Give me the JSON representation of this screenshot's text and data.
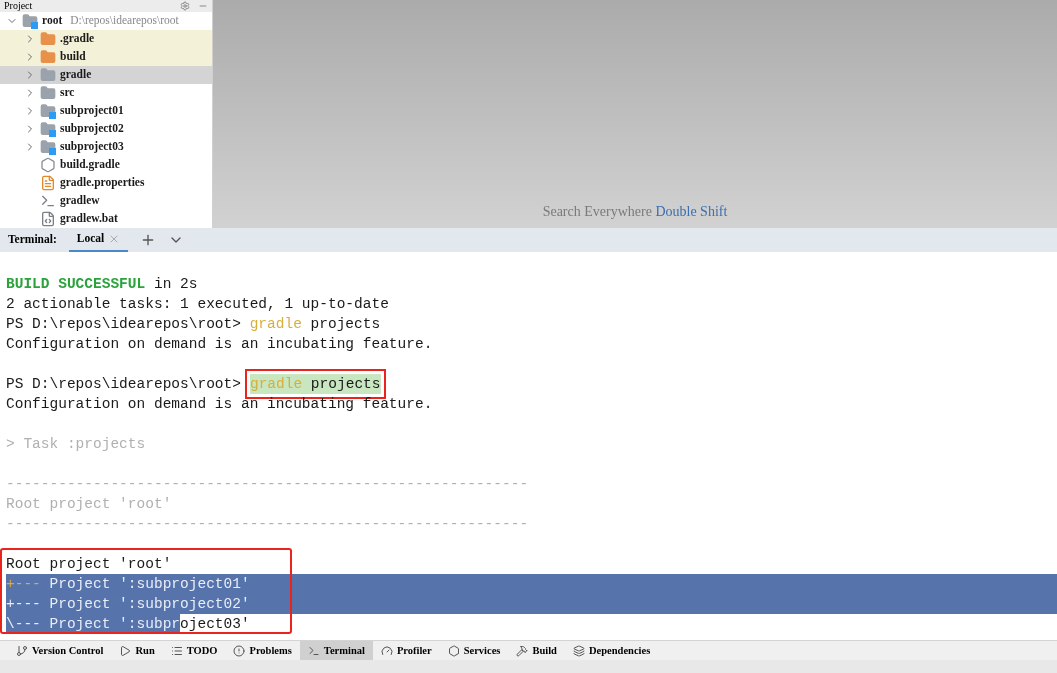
{
  "project_panel": {
    "title": "Project",
    "tree": [
      {
        "label": "root",
        "path": "D:\\repos\\idearepos\\root",
        "kind": "module",
        "expanded": true,
        "excluded": false,
        "selected": false,
        "children": [
          {
            "label": ".gradle",
            "kind": "folder",
            "expanded": false,
            "excluded": true,
            "selected": false
          },
          {
            "label": "build",
            "kind": "folder",
            "expanded": false,
            "excluded": true,
            "selected": false
          },
          {
            "label": "gradle",
            "kind": "folder",
            "expanded": false,
            "excluded": false,
            "selected": true
          },
          {
            "label": "src",
            "kind": "folder",
            "expanded": false,
            "excluded": false,
            "selected": false
          },
          {
            "label": "subproject01",
            "kind": "module",
            "expanded": false,
            "excluded": false,
            "selected": false
          },
          {
            "label": "subproject02",
            "kind": "module",
            "expanded": false,
            "excluded": false,
            "selected": false
          },
          {
            "label": "subproject03",
            "kind": "module",
            "expanded": false,
            "excluded": false,
            "selected": false
          },
          {
            "label": "build.gradle",
            "kind": "gradle",
            "excluded": false,
            "selected": false
          },
          {
            "label": "gradle.properties",
            "kind": "properties",
            "excluded": false,
            "selected": false
          },
          {
            "label": "gradlew",
            "kind": "script",
            "excluded": false,
            "selected": false
          },
          {
            "label": "gradlew.bat",
            "kind": "batch",
            "excluded": false,
            "selected": false
          }
        ]
      }
    ]
  },
  "editor_hint": {
    "text": "Search Everywhere",
    "shortcut": "Double Shift"
  },
  "terminal": {
    "title": "Terminal:",
    "tabs": [
      {
        "label": "Local",
        "selected": true
      }
    ],
    "output": [
      {
        "selected": false
      },
      {
        "selected": false,
        "segments": [
          {
            "text": "BUILD SUCCESSFUL",
            "kind": "success"
          },
          {
            "text": " in 2s",
            "kind": "normal"
          }
        ]
      },
      {
        "selected": false,
        "segments": [
          {
            "text": "2 actionable tasks: 1 executed, 1 up-to-date",
            "kind": "normal"
          }
        ]
      },
      {
        "selected": false,
        "segments": [
          {
            "text": "PS D:\\repos\\idearepos\\root> ",
            "kind": "normal"
          },
          {
            "text": "gradle",
            "kind": "command"
          },
          {
            "text": " projects",
            "kind": "normal"
          }
        ]
      },
      {
        "selected": false,
        "segments": [
          {
            "text": "Configuration on demand is an incubating feature.",
            "kind": "normal"
          }
        ]
      },
      {
        "selected": false
      },
      {
        "selected": false,
        "segments": [
          {
            "text": "PS D:\\repos\\idearepos\\root>",
            "kind": "normal"
          },
          {
            "text": "gradle",
            "kind": "command",
            "boxed": true,
            "highlighted": true
          },
          {
            "text": " projects",
            "kind": "normal",
            "boxed": true,
            "highlighted": true
          }
        ]
      },
      {
        "selected": false,
        "segments": [
          {
            "text": "Configuration on demand is an incubating feature.",
            "kind": "normal"
          }
        ]
      },
      {
        "selected": false
      },
      {
        "selected": false,
        "segments": [
          {
            "text": "> Task :projects",
            "kind": "dim"
          }
        ]
      },
      {
        "selected": false
      },
      {
        "selected": false,
        "segments": [
          {
            "text": "------------------------------------------------------------",
            "kind": "dim"
          }
        ]
      },
      {
        "selected": false,
        "segments": [
          {
            "text": "Root project 'root'",
            "kind": "dim"
          }
        ]
      },
      {
        "selected": false,
        "segments": [
          {
            "text": "------------------------------------------------------------",
            "kind": "dim"
          }
        ]
      },
      {
        "selected": false
      }
    ],
    "boxed_output": [
      {
        "selected": false,
        "segments": [
          {
            "text": "Root project 'root'",
            "kind": "normal"
          }
        ]
      },
      {
        "selected": true,
        "segments": [
          {
            "text": "+--- ",
            "kind": "command",
            "selected": false
          },
          {
            "text": "Project ':subproject01'",
            "kind": "normal",
            "selected": true
          }
        ]
      },
      {
        "selected": true,
        "segments": [
          {
            "text": "+--- Project ':subproject02'",
            "kind": "normal",
            "selected": true
          }
        ]
      },
      {
        "selected": false,
        "segments": [
          {
            "text": "\\--- Project ':subpr",
            "kind": "normal",
            "selected": true
          },
          {
            "text": "oject03'",
            "kind": "normal",
            "selected": false
          }
        ]
      }
    ]
  },
  "tool_windows": [
    {
      "label": "Version Control",
      "selected": false
    },
    {
      "label": "Run",
      "selected": false
    },
    {
      "label": "TODO",
      "selected": false
    },
    {
      "label": "Problems",
      "selected": false
    },
    {
      "label": "Terminal",
      "selected": true
    },
    {
      "label": "Profiler",
      "selected": false
    },
    {
      "label": "Services",
      "selected": false
    },
    {
      "label": "Build",
      "selected": false
    },
    {
      "label": "Dependencies",
      "selected": false
    }
  ]
}
